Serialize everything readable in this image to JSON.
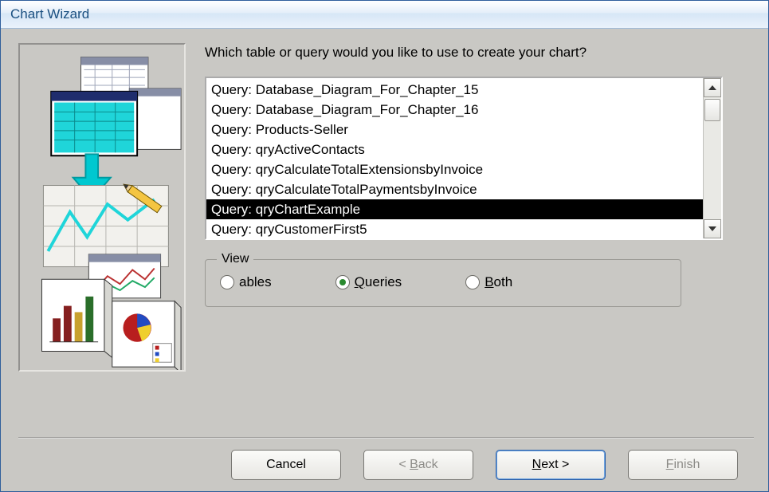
{
  "title": "Chart Wizard",
  "prompt": "Which table or query would you like to use to create your chart?",
  "list": {
    "selected_index": 6,
    "items": [
      "Query: Database_Diagram_For_Chapter_15",
      "Query: Database_Diagram_For_Chapter_16",
      "Query: Products-Seller",
      "Query: qryActiveContacts",
      "Query: qryCalculateTotalExtensionsbyInvoice",
      "Query: qryCalculateTotalPaymentsbyInvoice",
      "Query: qryChartExample",
      "Query: qryCustomerFirst5"
    ]
  },
  "view": {
    "label": "View",
    "options": {
      "tables": "Tables",
      "queries": "Queries",
      "both": "Both"
    },
    "selected": "queries"
  },
  "buttons": {
    "cancel": "Cancel",
    "back": "< Back",
    "next": "Next >",
    "finish": "Finish"
  }
}
